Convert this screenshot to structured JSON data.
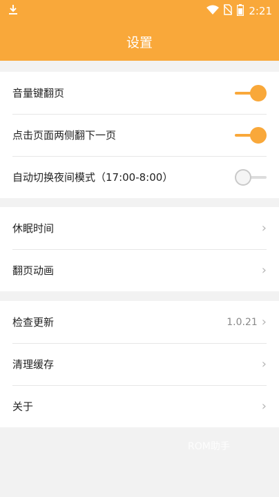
{
  "status_bar": {
    "time": "2:21",
    "left_icon": "download-icon",
    "right_icons": [
      "wifi-icon",
      "no-sim-icon",
      "battery-icon"
    ]
  },
  "app_bar": {
    "title": "设置"
  },
  "groups": [
    {
      "items": [
        {
          "label": "音量键翻页",
          "control": "switch",
          "value": true
        },
        {
          "label": "点击页面两侧翻下一页",
          "control": "switch",
          "value": true
        },
        {
          "label": "自动切换夜间模式（17:00-8:00）",
          "control": "switch",
          "value": false
        }
      ]
    },
    {
      "items": [
        {
          "label": "休眠时间",
          "control": "chevron"
        },
        {
          "label": "翻页动画",
          "control": "chevron"
        }
      ]
    },
    {
      "items": [
        {
          "label": "检查更新",
          "control": "chevron",
          "value": "1.0.21"
        },
        {
          "label": "清理缓存",
          "control": "chevron"
        },
        {
          "label": "关于",
          "control": "chevron"
        }
      ]
    }
  ],
  "watermark": "ROM助手",
  "colors": {
    "accent": "#f9a83a",
    "background": "#f2f2f2",
    "card": "#ffffff"
  }
}
